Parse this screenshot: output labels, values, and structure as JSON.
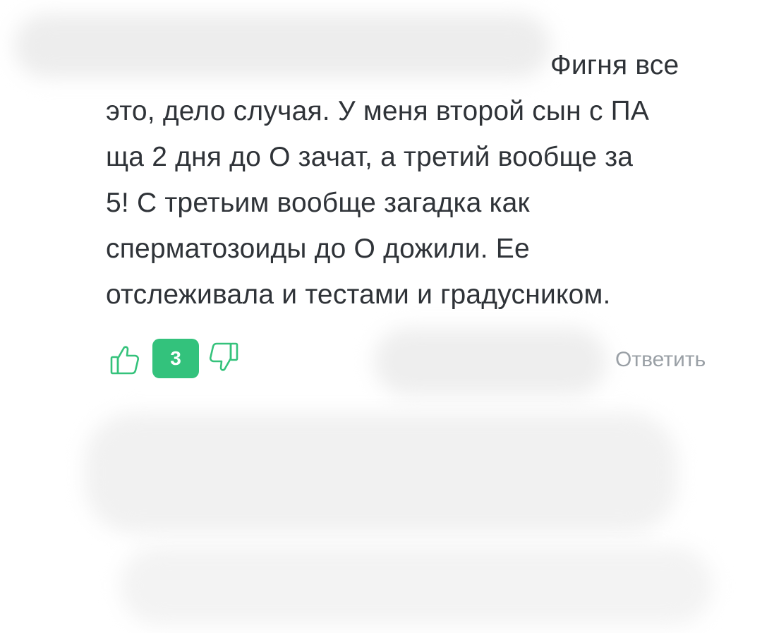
{
  "comment": {
    "text_lines": [
      "Фигня все",
      "это, дело случая. У меня второй сын с ПА",
      "ща 2 дня до О зачат, а третий вообще за",
      "5! С третьим вообще загадка как",
      "сперматозоиды до О дожили. Ее",
      "отслеживала и тестами и градусником."
    ],
    "votes": {
      "count": "3",
      "badge_color": "#33c27c",
      "like_icon": "thumbs-up-icon",
      "dislike_icon": "thumbs-down-icon"
    },
    "reply_label": "Ответить"
  }
}
